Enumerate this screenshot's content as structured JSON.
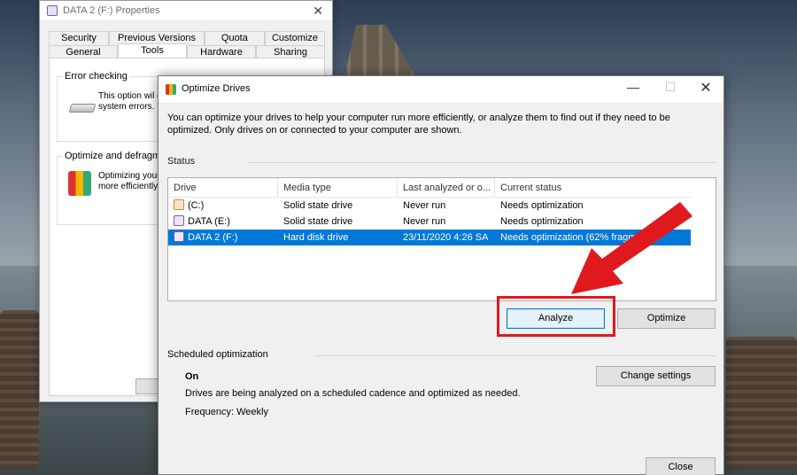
{
  "properties_window": {
    "title": "DATA 2 (F:) Properties",
    "tabs_top": [
      "Security",
      "Previous Versions",
      "Quota",
      "Customize"
    ],
    "tabs_bottom": [
      "General",
      "Tools",
      "Hardware",
      "Sharing"
    ],
    "active_tab": "Tools",
    "error_checking": {
      "title": "Error checking",
      "text": "This option wil c\nsystem errors."
    },
    "optimize": {
      "title": "Optimize and defragme",
      "text": "Optimizing your\nmore efficiently."
    }
  },
  "optimize_window": {
    "title": "Optimize Drives",
    "intro": "You can optimize your drives to help your computer run more efficiently, or analyze them to find out if they need to be optimized. Only drives on or connected to your computer are shown.",
    "status_label": "Status",
    "columns": [
      "Drive",
      "Media type",
      "Last analyzed or o...",
      "Current status"
    ],
    "drives": [
      {
        "drive": "(C:)",
        "media": "Solid state drive",
        "last": "Never run",
        "status": "Needs optimization",
        "icon": "system-drive-icon"
      },
      {
        "drive": "DATA (E:)",
        "media": "Solid state drive",
        "last": "Never run",
        "status": "Needs optimization",
        "icon": "drive-icon"
      },
      {
        "drive": "DATA 2 (F:)",
        "media": "Hard disk drive",
        "last": "23/11/2020 4:26 SA",
        "status": "Needs optimization (62% fragm",
        "icon": "drive-icon"
      }
    ],
    "selected_row": 2,
    "analyze_label": "Analyze",
    "optimize_label": "Optimize",
    "scheduled_label": "Scheduled optimization",
    "schedule_state": "On",
    "schedule_desc": "Drives are being analyzed on a scheduled cadence and optimized as needed.",
    "frequency": "Frequency: Weekly",
    "change_settings_label": "Change settings",
    "close_label": "Close"
  },
  "colors": {
    "selection": "#0078d7",
    "annotation_red": "#e0191e"
  }
}
